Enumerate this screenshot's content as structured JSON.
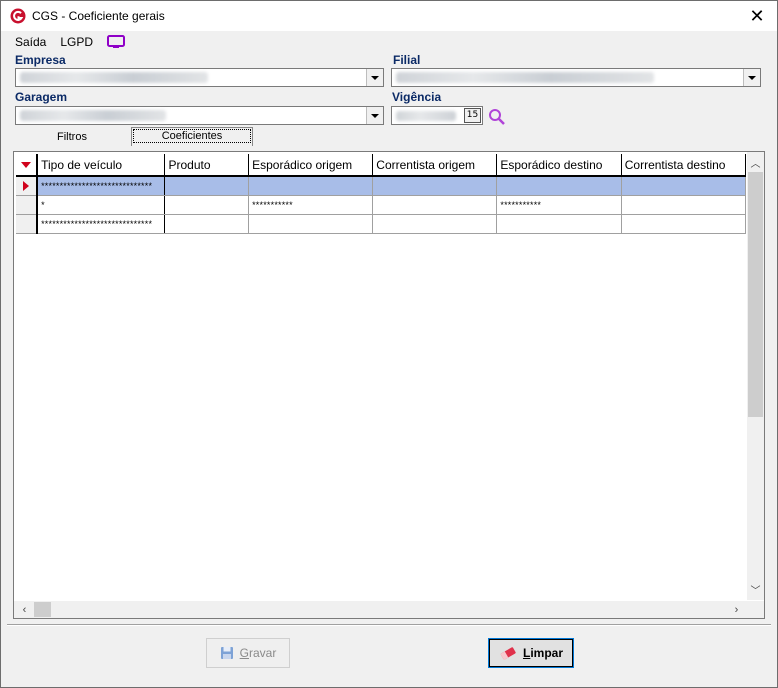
{
  "window": {
    "title": "CGS - Coeficiente gerais",
    "close_glyph": "✕"
  },
  "menu": {
    "items": [
      "Saída",
      "LGPD"
    ],
    "lgpd_icon": "monitor-icon"
  },
  "form": {
    "empresa_label": "Empresa",
    "filial_label": "Filial",
    "garagem_label": "Garagem",
    "vigencia_label": "Vigência",
    "calendar_glyph": "15"
  },
  "tabs": [
    {
      "label": "Filtros"
    },
    {
      "label": "Coeficientes",
      "active": true
    }
  ],
  "grid": {
    "columns": [
      "Tipo de veículo",
      "Produto",
      "Esporádico origem",
      "Correntista origem",
      "Esporádico destino",
      "Correntista destino"
    ],
    "rows": [
      {
        "selected": true,
        "cells": [
          "******************************",
          "",
          "",
          "",
          "",
          ""
        ]
      },
      {
        "selected": false,
        "cells": [
          "*",
          "",
          "***********",
          "",
          "***********",
          ""
        ]
      },
      {
        "selected": false,
        "cells": [
          "******************************",
          "",
          "",
          "",
          "",
          ""
        ]
      }
    ]
  },
  "buttons": {
    "gravar_first": "G",
    "gravar_rest": "ravar",
    "limpar_first": "L",
    "limpar_rest": "impar"
  },
  "colors": {
    "accent": "#0b2a66",
    "selection": "#a8bde8",
    "indicator": "#d0021b",
    "lgpd_icon": "#8f00c7"
  }
}
